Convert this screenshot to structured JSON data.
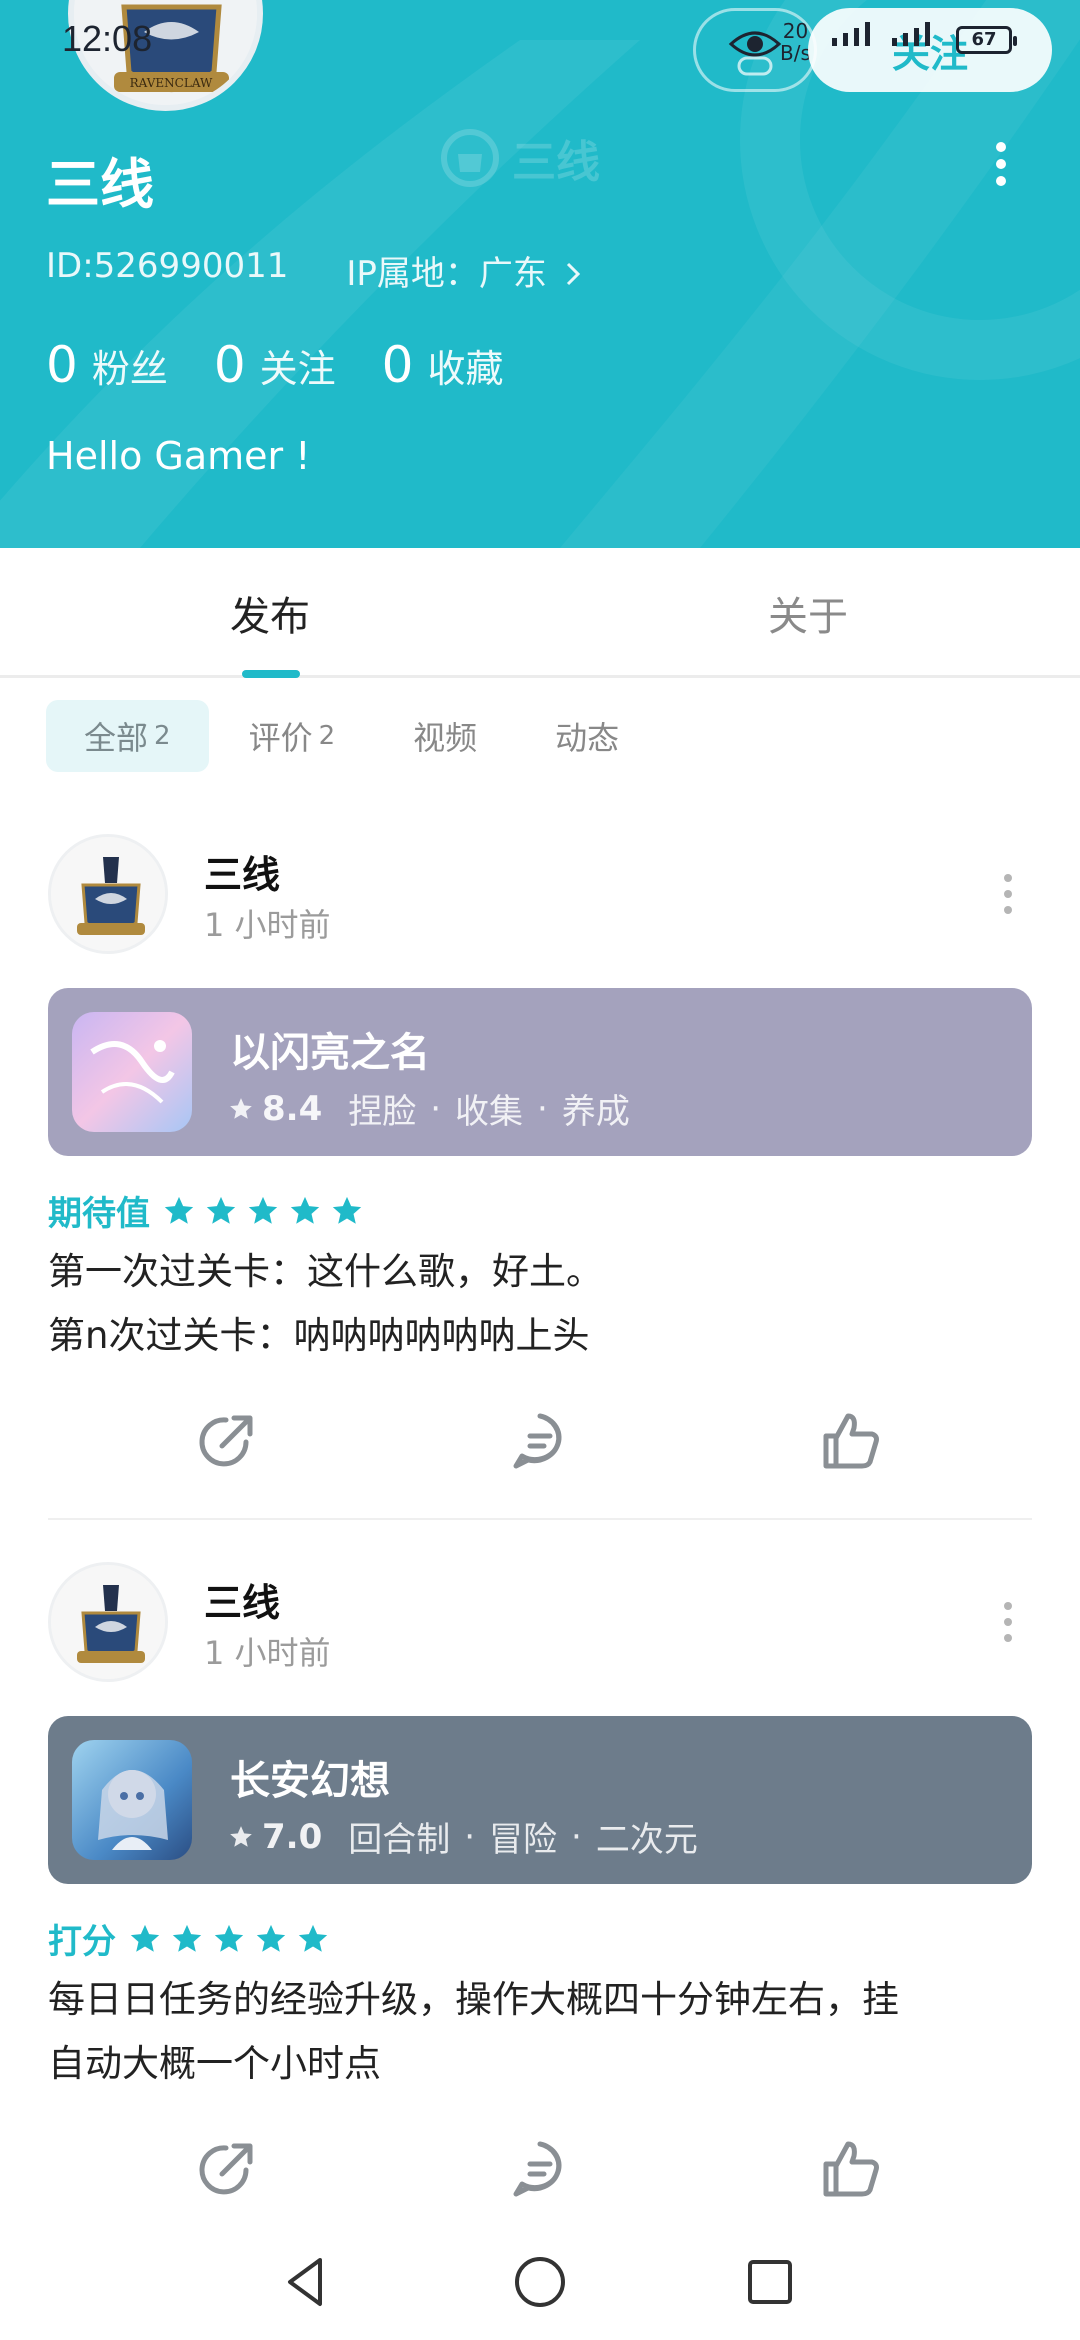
{
  "status_bar": {
    "time": "12:08",
    "net_speed_top": "20",
    "net_speed_bottom": "B/s",
    "signal_1": "5G",
    "signal_2": "4G",
    "battery": "67"
  },
  "header": {
    "follow_label": "关注",
    "username": "三线",
    "watermark_text": "三线",
    "user_id": "ID:526990011",
    "ip_location": "IP属地：广东",
    "stats": [
      {
        "num": "0",
        "label": "粉丝"
      },
      {
        "num": "0",
        "label": "关注"
      },
      {
        "num": "0",
        "label": "收藏"
      }
    ],
    "bio": "Hello Gamer !",
    "bg_color": "#20bac9"
  },
  "tabs": [
    {
      "label": "发布",
      "active": true
    },
    {
      "label": "关于",
      "active": false
    }
  ],
  "filters": [
    {
      "label": "全部",
      "count": "2",
      "active": true
    },
    {
      "label": "评价",
      "count": "2",
      "active": false
    },
    {
      "label": "视频",
      "count": "",
      "active": false
    },
    {
      "label": "动态",
      "count": "",
      "active": false
    }
  ],
  "posts": [
    {
      "author": "三线",
      "time": "1 小时前",
      "game": {
        "title": "以闪亮之名",
        "score": "8.4",
        "tags": [
          "捏脸",
          "收集",
          "养成"
        ],
        "card_color": "#a4a2bd"
      },
      "rating_label": "期待值",
      "stars": 5,
      "text_lines": [
        "第一次过关卡：这什么歌，好土。",
        "第n次过关卡：呐呐呐呐呐呐上头"
      ]
    },
    {
      "author": "三线",
      "time": "1 小时前",
      "game": {
        "title": "长安幻想",
        "score": "7.0",
        "tags": [
          "回合制",
          "冒险",
          "二次元"
        ],
        "card_color": "#6d7c8b"
      },
      "rating_label": "打分",
      "stars": 5,
      "text_lines": [
        "每日日任务的经验升级，操作大概四十分钟左右，挂",
        "自动大概一个小时点"
      ]
    }
  ],
  "icons": {
    "share": "share-icon",
    "comment": "comment-icon",
    "like": "thumbs-up-icon",
    "nav_back": "back-triangle-icon",
    "nav_home": "home-circle-icon",
    "nav_recent": "recent-square-icon"
  },
  "accent_color": "#20bac9"
}
